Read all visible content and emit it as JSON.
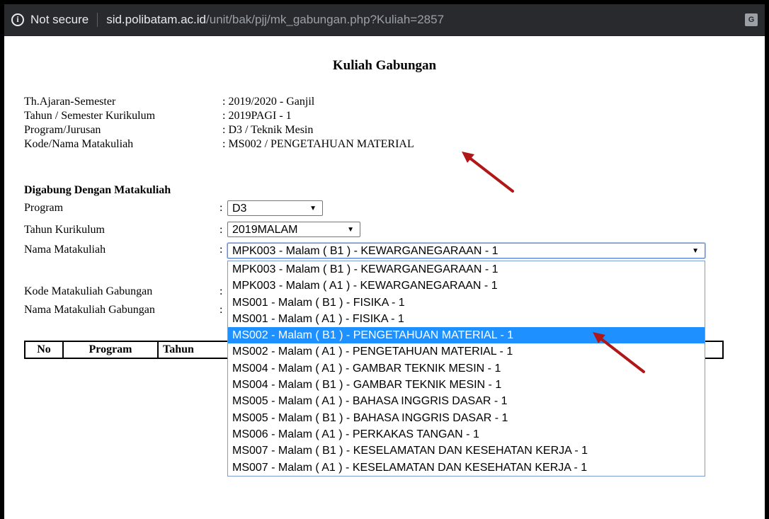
{
  "browser": {
    "security_icon": "info-icon",
    "security_label": "Not secure",
    "url_host": "sid.polibatam.ac.id",
    "url_path": "/unit/bak/pjj/mk_gabungan.php?Kuliah=2857",
    "translate_icon": "translate-icon"
  },
  "page": {
    "title": "Kuliah Gabungan",
    "info": [
      {
        "label": "Th.Ajaran-Semester",
        "value": ": 2019/2020 - Ganjil"
      },
      {
        "label": "Tahun / Semester Kurikulum",
        "value": ": 2019PAGI - 1"
      },
      {
        "label": "Program/Jurusan",
        "value": ": D3 / Teknik Mesin"
      },
      {
        "label": "Kode/Nama Matakuliah",
        "value": ": MS002 / PENGETAHUAN MATERIAL"
      }
    ],
    "merge_section_title": "Digabung Dengan Matakuliah",
    "form": {
      "program_label": "Program",
      "program_value": "D3",
      "kurikulum_label": "Tahun Kurikulum",
      "kurikulum_value": "2019MALAM",
      "matakuliah_label": "Nama Matakuliah",
      "matakuliah_value": "MPK003 - Malam ( B1 ) - KEWARGANEGARAAN - 1",
      "kode_gabungan_label": "Kode Matakuliah Gabungan",
      "nama_gabungan_label": "Nama Matakuliah Gabungan",
      "colon": ":"
    },
    "dropdown_options": [
      "MPK003 - Malam ( B1 ) - KEWARGANEGARAAN - 1",
      "MPK003 - Malam ( A1 ) - KEWARGANEGARAAN - 1",
      "MS001 - Malam ( B1 ) - FISIKA - 1",
      "MS001 - Malam ( A1 ) - FISIKA - 1",
      "MS002 - Malam ( B1 ) - PENGETAHUAN MATERIAL - 1",
      "MS002 - Malam ( A1 ) - PENGETAHUAN MATERIAL - 1",
      "MS004 - Malam ( A1 ) - GAMBAR TEKNIK MESIN - 1",
      "MS004 - Malam ( B1 ) - GAMBAR TEKNIK MESIN - 1",
      "MS005 - Malam ( A1 ) - BAHASA INGGRIS DASAR - 1",
      "MS005 - Malam ( B1 ) - BAHASA INGGRIS DASAR - 1",
      "MS006 - Malam ( A1 ) - PERKAKAS TANGAN - 1",
      "MS007 - Malam ( B1 ) - KESELAMATAN DAN KESEHATAN KERJA - 1",
      "MS007 - Malam ( A1 ) - KESELAMATAN DAN KESEHATAN KERJA - 1"
    ],
    "highlighted_option": "MS002 - Malam ( B1 ) - PENGETAHUAN MATERIAL - 1",
    "table_headers": [
      "No",
      "Program",
      "Tahun"
    ]
  },
  "colors": {
    "highlight": "#1e90ff",
    "annotation_arrow": "#b01818",
    "addressbar": "#292a2d"
  }
}
